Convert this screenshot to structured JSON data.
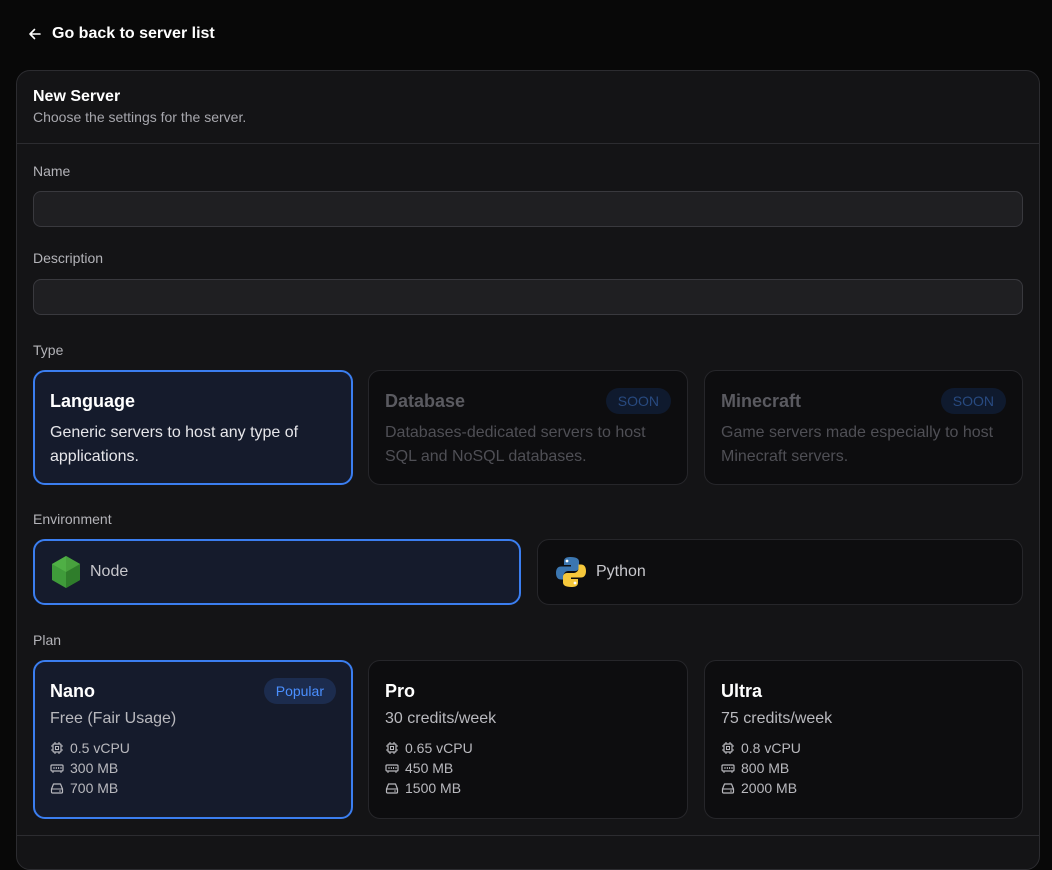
{
  "nav": {
    "back_label": "Go back to server list"
  },
  "card": {
    "title": "New Server",
    "subtitle": "Choose the settings for the server."
  },
  "form": {
    "name_label": "Name",
    "name_value": "",
    "description_label": "Description",
    "description_value": "",
    "type_label": "Type",
    "environment_label": "Environment",
    "plan_label": "Plan"
  },
  "types": [
    {
      "title": "Language",
      "description": "Generic servers to host any type of applications.",
      "selected": true,
      "badge": ""
    },
    {
      "title": "Database",
      "description": "Databases-dedicated servers to host SQL and NoSQL databases.",
      "selected": false,
      "badge": "SOON"
    },
    {
      "title": "Minecraft",
      "description": "Game servers made especially to host Minecraft servers.",
      "selected": false,
      "badge": "SOON"
    }
  ],
  "environments": [
    {
      "label": "Node",
      "icon": "nodejs-icon",
      "selected": true
    },
    {
      "label": "Python",
      "icon": "python-icon",
      "selected": false
    }
  ],
  "plans": [
    {
      "title": "Nano",
      "price": "Free (Fair Usage)",
      "badge": "Popular",
      "cpu": "0.5 vCPU",
      "ram": "300 MB",
      "disk": "700 MB",
      "selected": true
    },
    {
      "title": "Pro",
      "price": "30 credits/week",
      "badge": "",
      "cpu": "0.65 vCPU",
      "ram": "450 MB",
      "disk": "1500 MB",
      "selected": false
    },
    {
      "title": "Ultra",
      "price": "75 credits/week",
      "badge": "",
      "cpu": "0.8 vCPU",
      "ram": "800 MB",
      "disk": "2000 MB",
      "selected": false
    }
  ],
  "colors": {
    "background": "#080808",
    "card": "#141416",
    "accent": "#3b7ef0",
    "selected_bg": "#151b2c",
    "muted_text": "#b3b3b8"
  }
}
